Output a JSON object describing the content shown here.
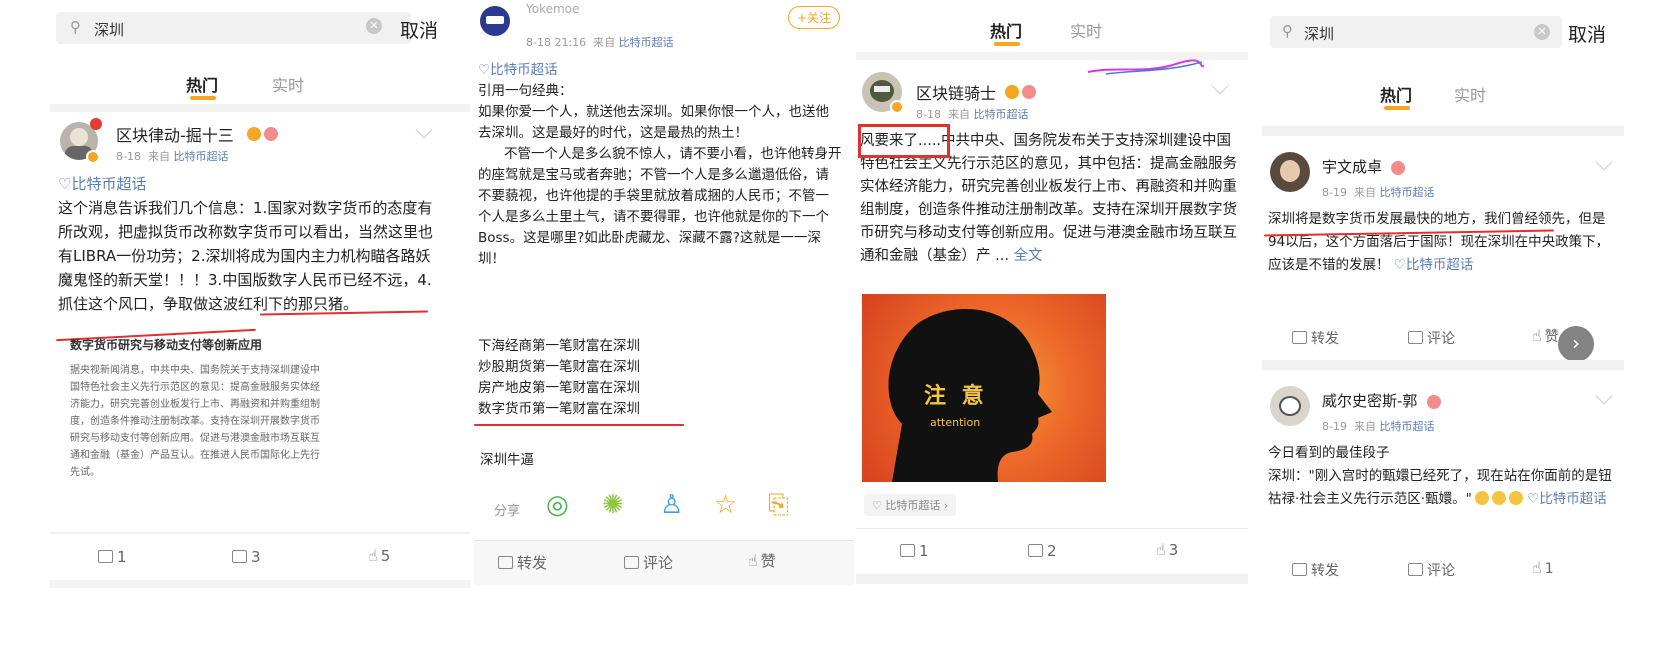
{
  "colors": {
    "accent": "#f5a623",
    "link": "#5b7fb5",
    "annotation_red": "#e03030",
    "scribble": "#d83ad8"
  },
  "panel1": {
    "search_text": "深圳",
    "cancel": "取消",
    "tabs": [
      "热门",
      "实时"
    ],
    "post": {
      "username": "区块律动-掘十三",
      "time": "8-18",
      "from_label": "来自",
      "source": "比特币超话",
      "topic": "♡比特币超话",
      "text": "这个消息告诉我们几个信息：1.国家对数字货币的态度有所改观，把虚拟货币改称数字货币可以看出，当然这里也有LIBRA一份功劳；2.深圳将成为国内主力机构瞄各路妖魔鬼怪的新天堂！！！3.中国版数字人民币已经不远，4.抓住这个风口，争取做这波红利下的那只猪。",
      "attach_title": "数字货币研究与移动支付等创新应用",
      "attach_text": "据央视新闻消息，中共中央、国务院关于支持深圳建设中国特色社会主义先行示范区的意见：提高金融服务实体经济能力，研究完善创业板发行上市、再融资和并购重组制度，创造条件推动注册制改革。支持在深圳开展数字货币研究与移动支付等创新应用。促进与港澳金融市场互联互通和金融（基金）产品互认。在推进人民币国际化上先行先试。",
      "repost": "1",
      "comment": "3",
      "like": "5"
    }
  },
  "panel2": {
    "username": "Yokemoe",
    "follow": "+关注",
    "time": "8-18 21:16",
    "from_label": "来自",
    "source": "比特币超话",
    "topic": "♡比特币超话",
    "text1": "引用一句经典：",
    "text2": "如果你爱一个人，就送他去深圳。如果你恨一个人，也送他去深圳。这是最好的时代，这是最热的热土！",
    "text3": "不管一个人是多么貌不惊人，请不要小看，也许他转身开的座驾就是宝马或者奔驰；不管一个人是多么邋遢低俗，请不要藐视，也许他提的手袋里就放着成捆的人民币；不管一个人是多么土里土气，请不要得罪，也许他就是你的下一个Boss。这是哪里?如此卧虎藏龙、深藏不露?这就是一一深圳！",
    "list": [
      "下海经商第一笔财富在深圳",
      "炒股期货第一笔财富在深圳",
      "房产地皮第一笔财富在深圳",
      "数字货币第一笔财富在深圳"
    ],
    "sign": "深圳牛逼",
    "share_label": "分享",
    "repost": "转发",
    "comment": "评论",
    "like": "赞"
  },
  "panel3": {
    "tabs": [
      "热门",
      "实时"
    ],
    "username": "区块链骑士",
    "time": "8-18",
    "from_label": "来自",
    "source": "比特币超话",
    "lead": "风要来了.....",
    "text": "中共中央、国务院发布关于支持深圳建设中国特色社会主义先行示范区的意见，其中包括：提高金融服务实体经济能力，研究完善创业板发行上市、再融资和并购重组制度，创造条件推动注册制改革。支持在深圳开展数字货币研究与移动支付等创新应用。促进与港澳金融市场互联互通和金融（基金）产 ...",
    "more": "全文",
    "image_title": "注 意",
    "image_sub": "attention",
    "topic_chip": "比特币超话",
    "repost": "1",
    "comment": "2",
    "like": "3"
  },
  "panel4": {
    "search_text": "深圳",
    "cancel": "取消",
    "tabs": [
      "热门",
      "实时"
    ],
    "post1": {
      "username": "宇文成卓",
      "time": "8-19",
      "from_label": "来自",
      "source": "比特币超话",
      "text": "深圳将是数字货币发展最快的地方，我们曾经领先，但是94以后，这个方面落后于国际！现在深圳在中央政策下，应该是不错的发展！",
      "topic": "♡比特币超话",
      "repost": "转发",
      "comment": "评论",
      "like": "赞"
    },
    "post2": {
      "username": "威尔史密斯-郭",
      "time": "8-19",
      "from_label": "来自",
      "source": "比特币超话",
      "text1": "今日看到的最佳段子",
      "text2": "深圳：\"刚入宫时的甄嬛已经死了，现在站在你面前的是钮祜禄·社会主义先行示范区·甄嬛。\"",
      "topic": "♡比特币超话",
      "repost": "转发",
      "comment": "评论",
      "like": "1"
    }
  }
}
